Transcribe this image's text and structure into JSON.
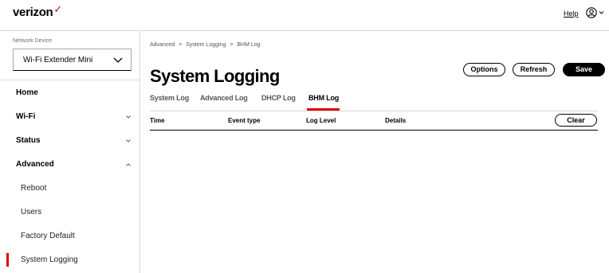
{
  "brand": {
    "logo_text": "verizon",
    "logo_mark": "✓",
    "accent": "#e00000"
  },
  "header": {
    "help_label": "Help",
    "user_icon": "user-circle-icon"
  },
  "sidebar": {
    "network_device_label": "Network Device",
    "device_value": "Wi-Fi Extender Mini",
    "items": [
      {
        "label": "Home",
        "level": "top"
      },
      {
        "label": "Wi-Fi",
        "level": "top",
        "chevron": "down"
      },
      {
        "label": "Status",
        "level": "top",
        "chevron": "down"
      },
      {
        "label": "Advanced",
        "level": "top",
        "chevron": "up"
      },
      {
        "label": "Reboot",
        "level": "sub"
      },
      {
        "label": "Users",
        "level": "sub"
      },
      {
        "label": "Factory Default",
        "level": "sub"
      },
      {
        "label": "System Logging",
        "level": "sub",
        "active": true
      }
    ]
  },
  "main": {
    "breadcrumb": [
      "Advanced",
      ">",
      "System Logging",
      ">",
      "BHM Log"
    ],
    "title": "System Logging",
    "buttons": {
      "options": "Options",
      "refresh": "Refresh",
      "save": "Save",
      "clear": "Clear"
    },
    "tabs": [
      {
        "label": "System Log"
      },
      {
        "label": "Advanced Log"
      },
      {
        "label": "DHCP Log"
      },
      {
        "label": "BHM Log",
        "active": true
      }
    ],
    "columns": [
      "Time",
      "Event type",
      "Log Level",
      "Details"
    ]
  }
}
